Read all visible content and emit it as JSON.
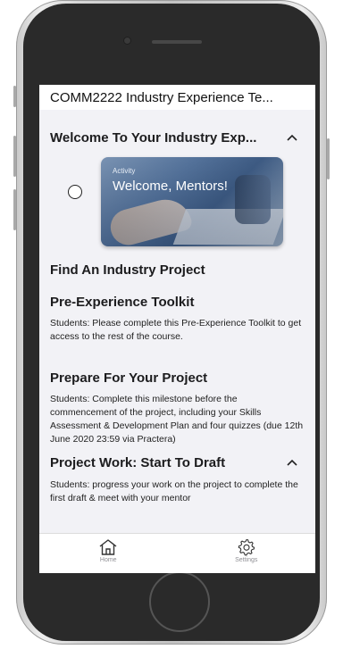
{
  "app": {
    "title": "COMM2222 Industry Experience Te..."
  },
  "sections": {
    "welcome": {
      "title": "Welcome To Your Industry Exp...",
      "activity_kicker": "Activity",
      "activity_title": "Welcome, Mentors!"
    },
    "find_project": {
      "title": "Find An Industry Project"
    },
    "toolkit": {
      "title": "Pre-Experience Toolkit",
      "description": "Students: Please complete this Pre-Experience Toolkit to get access to the rest of the course."
    },
    "prepare": {
      "title": "Prepare For Your Project",
      "description": "Students: Complete this milestone before the commencement of the project, including your Skills Assessment & Development Plan and four quizzes (due 12th June 2020 23:59 via Practera)"
    },
    "project_work": {
      "title": "Project Work: Start To Draft",
      "description": "Students: progress your work on the project to complete the first draft & meet with your mentor"
    }
  },
  "tabbar": {
    "home_label": "Home",
    "settings_label": "Settings"
  },
  "icons": {
    "chevron": "chevron-up-icon",
    "home": "home-icon",
    "settings": "gear-icon"
  },
  "colors": {
    "screen_bg": "#f2f2f6",
    "tab_label": "#8e8e93",
    "phone_body": "#2a2a2a"
  }
}
